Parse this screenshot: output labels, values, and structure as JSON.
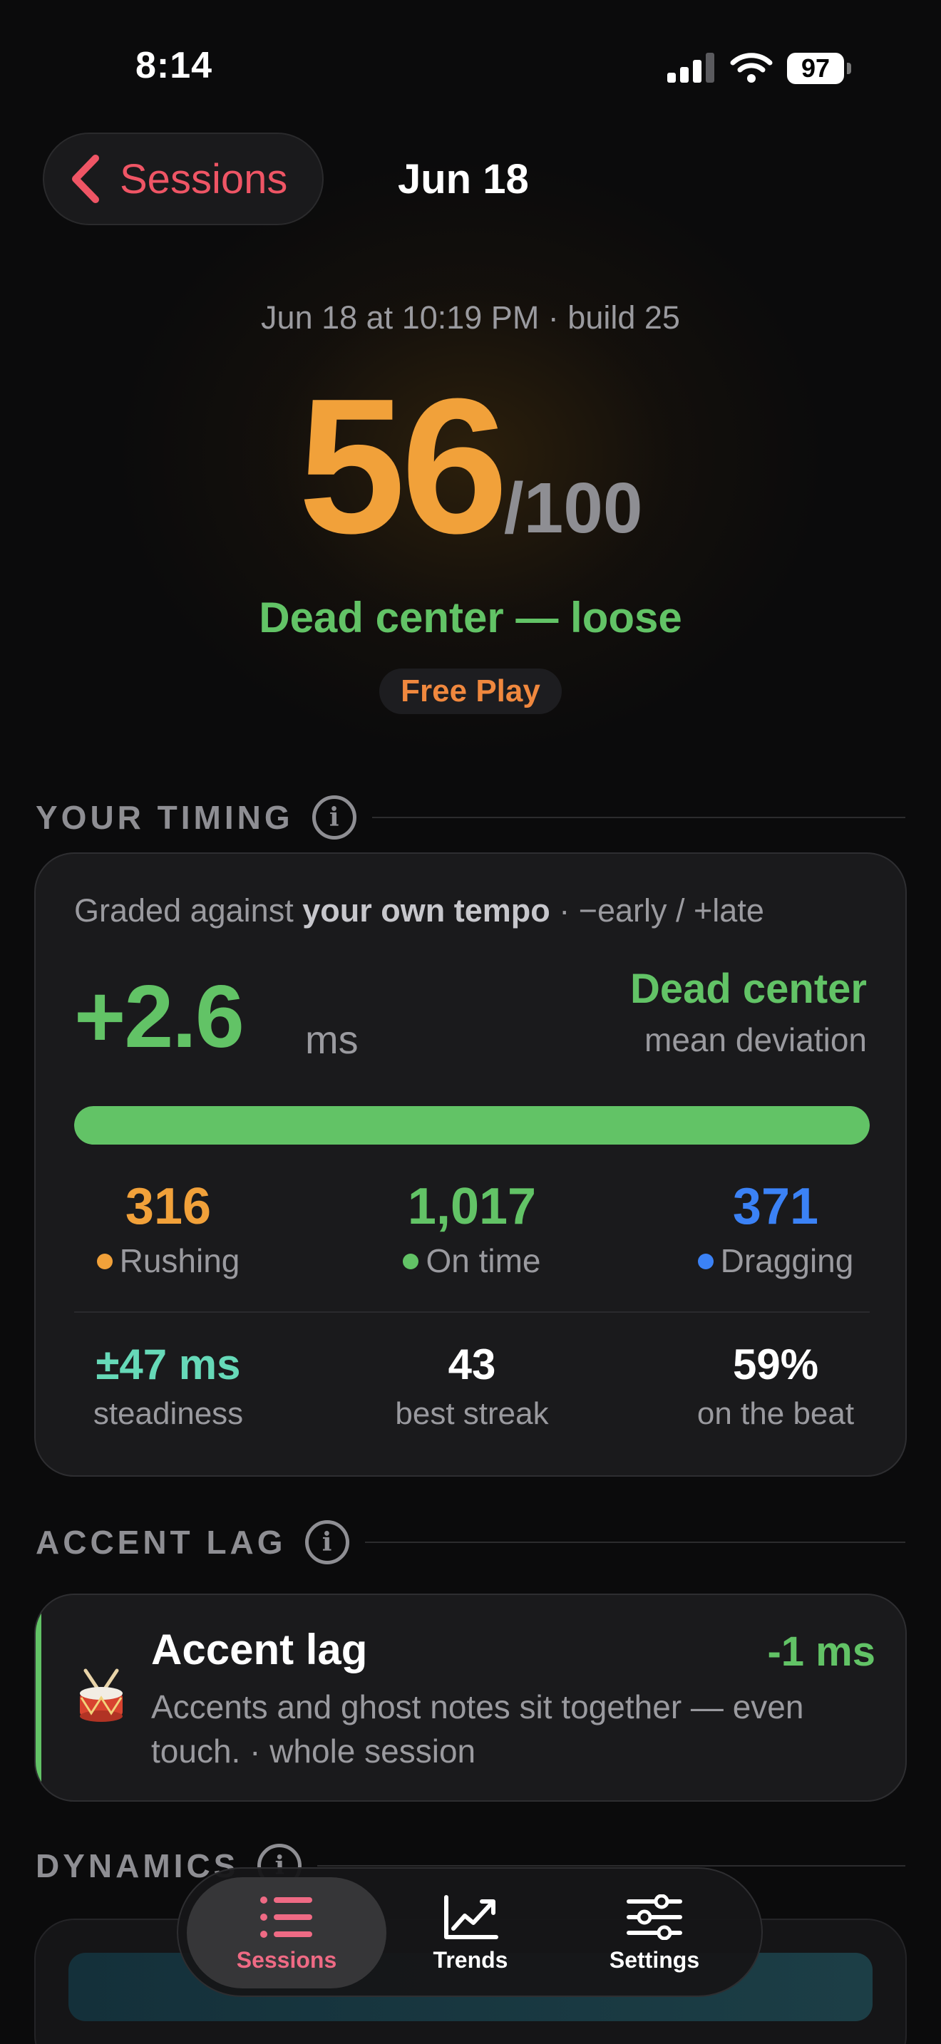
{
  "status_bar": {
    "time": "8:14",
    "battery": "97"
  },
  "nav": {
    "back_label": "Sessions",
    "title": "Jun 18"
  },
  "hero": {
    "subtitle": "Jun 18 at 10:19 PM · build 25",
    "score": "56",
    "score_max": "/100",
    "verdict": "Dead center — loose",
    "mode": "Free Play"
  },
  "timing": {
    "section_title": "YOUR TIMING",
    "grade_prefix": "Graded against ",
    "grade_bold": "your own tempo",
    "grade_suffix": " · −early / +late",
    "deviation_value": "+2.6",
    "deviation_unit": "ms",
    "deviation_verdict": "Dead center",
    "deviation_caption": "mean deviation",
    "bar_fill_fraction": 1.0,
    "counts": [
      {
        "value": "316",
        "label": "Rushing",
        "color": "#f1a13a"
      },
      {
        "value": "1,017",
        "label": "On time",
        "color": "#62c366"
      },
      {
        "value": "371",
        "label": "Dragging",
        "color": "#3b82f6"
      }
    ],
    "stats": [
      {
        "value": "±47 ms",
        "label": "steadiness",
        "color": "#66d9b8"
      },
      {
        "value": "43",
        "label": "best streak",
        "color": "#ffffff"
      },
      {
        "value": "59%",
        "label": "on the beat",
        "color": "#ffffff"
      }
    ]
  },
  "accent_lag": {
    "section_title": "ACCENT LAG",
    "title": "Accent lag",
    "value": "-1 ms",
    "description": "Accents and ghost notes sit together — even touch. · whole session"
  },
  "dynamics": {
    "section_title": "DYNAMICS"
  },
  "tabs": [
    {
      "label": "Sessions",
      "icon": "list-icon",
      "active": true
    },
    {
      "label": "Trends",
      "icon": "trend-chart-icon",
      "active": false
    },
    {
      "label": "Settings",
      "icon": "sliders-icon",
      "active": false
    }
  ],
  "colors": {
    "accent_red": "#ef5565",
    "score_orange": "#f1a13a",
    "success_green": "#62c366",
    "drag_blue": "#3b82f6",
    "mode_orange": "#f0883e"
  }
}
